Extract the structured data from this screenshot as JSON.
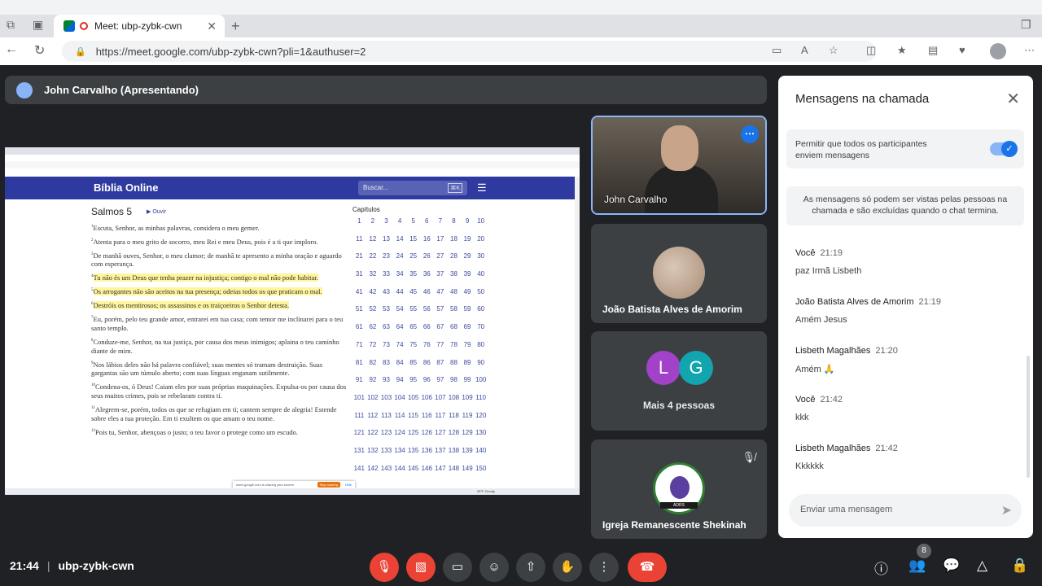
{
  "browser": {
    "tab_title": "Meet: ubp-zybk-cwn",
    "url": "https://meet.google.com/ubp-zybk-cwn?pli=1&authuser=2"
  },
  "presenter_bar": {
    "label": "John Carvalho (Apresentando)"
  },
  "shared_screen": {
    "site_logo": "Bíblia Online",
    "search_placeholder": "Buscar...",
    "search_shortcut": "⌘K",
    "chapter_title": "Salmos 5",
    "listen_label": "Ouvir",
    "chapters_label": "Capítulos",
    "verses": [
      {
        "n": "1",
        "text": "Escuta, Senhor, as minhas palavras, considera o meu gemer.",
        "highlight": false
      },
      {
        "n": "2",
        "text": "Atenta para o meu grito de socorro, meu Rei e meu Deus, pois é a ti que imploro.",
        "highlight": false
      },
      {
        "n": "3",
        "text": "De manhã ouves, Senhor, o meu clamor; de manhã te apresento a minha oração e aguardo com esperança.",
        "highlight": false
      },
      {
        "n": "4",
        "text": "Tu não és um Deus que tenha prazer na injustiça; contigo o mal não pode habitar.",
        "highlight": true
      },
      {
        "n": "5",
        "text": "Os arrogantes não são aceitos na tua presença; odeias todos os que praticam o mal.",
        "highlight": true
      },
      {
        "n": "6",
        "text": "Destróis os mentirosos; os assassinos e os traiçoeiros o Senhor detesta.",
        "highlight": true
      },
      {
        "n": "7",
        "text": "Eu, porém, pelo teu grande amor, entrarei em tua casa; com temor me inclinarei para o teu santo templo.",
        "highlight": false
      },
      {
        "n": "8",
        "text": "Conduze-me, Senhor, na tua justiça, por causa dos meus inimigos; aplaina o teu caminho diante de mim.",
        "highlight": false
      },
      {
        "n": "9",
        "text": "Nos lábios deles não há palavra confiável; suas mentes só tramam destruição. Suas gargantas são um túmulo aberto; com suas línguas enganam sutilmente.",
        "highlight": false
      },
      {
        "n": "10",
        "text": "Condena-os, ó Deus! Caiam eles por suas próprias maquinações. Expulsa-os por causa dos seus muitos crimes, pois se rebelaram contra ti.",
        "highlight": false
      },
      {
        "n": "11",
        "text": "Alegrem-se, porém, todos os que se refugiam em ti; cantem sempre de alegria! Estende sobre eles a tua proteção. Em ti exultem os que amam o teu nome.",
        "highlight": false
      },
      {
        "n": "12",
        "text": "Pois tu, Senhor, abençoas o justo; o teu favor o protege como um escudo.",
        "highlight": false
      }
    ],
    "chapters": [
      "1",
      "2",
      "3",
      "4",
      "5",
      "6",
      "7",
      "8",
      "9",
      "10",
      "11",
      "12",
      "13",
      "14",
      "15",
      "16",
      "17",
      "18",
      "19",
      "20",
      "21",
      "22",
      "23",
      "24",
      "25",
      "26",
      "27",
      "28",
      "29",
      "30",
      "31",
      "32",
      "33",
      "34",
      "35",
      "36",
      "37",
      "38",
      "39",
      "40",
      "41",
      "42",
      "43",
      "44",
      "45",
      "46",
      "47",
      "48",
      "49",
      "50",
      "51",
      "52",
      "53",
      "54",
      "55",
      "56",
      "57",
      "58",
      "59",
      "60",
      "61",
      "62",
      "63",
      "64",
      "65",
      "66",
      "67",
      "68",
      "69",
      "70",
      "71",
      "72",
      "73",
      "74",
      "75",
      "76",
      "77",
      "78",
      "79",
      "80",
      "81",
      "82",
      "83",
      "84",
      "85",
      "86",
      "87",
      "88",
      "89",
      "90",
      "91",
      "92",
      "93",
      "94",
      "95",
      "96",
      "97",
      "98",
      "99",
      "100",
      "101",
      "102",
      "103",
      "104",
      "105",
      "106",
      "107",
      "108",
      "109",
      "110",
      "111",
      "112",
      "113",
      "114",
      "115",
      "116",
      "117",
      "118",
      "119",
      "120",
      "121",
      "122",
      "123",
      "124",
      "125",
      "126",
      "127",
      "128",
      "129",
      "130",
      "131",
      "132",
      "133",
      "134",
      "135",
      "136",
      "137",
      "138",
      "139",
      "140",
      "141",
      "142",
      "143",
      "144",
      "145",
      "146",
      "147",
      "148",
      "149",
      "150"
    ],
    "share_notice": "meet.google.com is sharing your screen.",
    "stop_sharing": "Stop sharing",
    "hide": "Hide",
    "taskbar_weather": "25°F Cloudy"
  },
  "participants": [
    {
      "name": "John Carvalho",
      "type": "video"
    },
    {
      "name": "João Batista Alves de Amorim",
      "type": "photo"
    },
    {
      "summary": "Mais 4 pessoas",
      "initials": [
        "L",
        "G"
      ],
      "colors": [
        "#a142c8",
        "#12a4af"
      ]
    },
    {
      "name": "Igreja Remanescente Shekinah",
      "type": "logo",
      "logo_text": "ADRS",
      "muted": true
    }
  ],
  "chat": {
    "title": "Mensagens na chamada",
    "permission_text": "Permitir que todos os participantes enviem mensagens",
    "permission_on": true,
    "info_text": "As mensagens só podem ser vistas pelas pessoas na chamada e são excluídas quando o chat termina.",
    "messages": [
      {
        "sender": "Você",
        "time": "21:19",
        "text": "paz Irmã Lisbeth"
      },
      {
        "sender": "João Batista Alves de Amorim",
        "time": "21:19",
        "text": "Amém Jesus"
      },
      {
        "sender": "Lisbeth Magalhães",
        "time": "21:20",
        "text": "Amém 🙏"
      },
      {
        "sender": "Você",
        "time": "21:42",
        "text": "kkk"
      },
      {
        "sender": "Lisbeth Magalhães",
        "time": "21:42",
        "text": "Kkkkkk"
      }
    ],
    "input_placeholder": "Enviar uma mensagem"
  },
  "bottom_bar": {
    "clock": "21:44",
    "meeting_code": "ubp-zybk-cwn",
    "people_count": "8"
  },
  "colors": {
    "meet_bg": "#202124",
    "tile_bg": "#3c4043",
    "danger": "#ea4335",
    "accent": "#1a73e8",
    "bible_header": "#2e3a9f",
    "highlight": "#fff59d"
  }
}
